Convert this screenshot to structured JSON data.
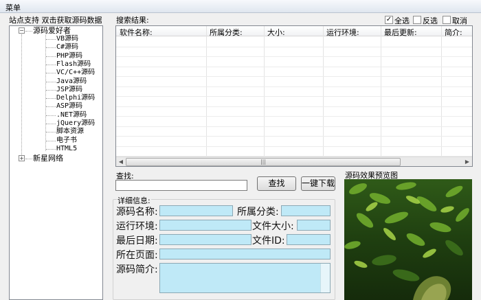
{
  "menu": {
    "label": "菜单"
  },
  "hint": {
    "text": "站点支持 双击获取源码数据"
  },
  "tree": {
    "root1": "源码爱好者",
    "children": [
      "VB源码",
      "C#源码",
      "PHP源码",
      "Flash源码",
      "VC/C++源码",
      "Java源码",
      "JSP源码",
      "Delphi源码",
      "ASP源码",
      ".NET源码",
      "jQuery源码",
      "脚本资源",
      "电子书",
      "HTML5"
    ],
    "root2": "新星网络"
  },
  "results": {
    "label": "搜索结果:",
    "columns": [
      "软件名称:",
      "所属分类:",
      "大小:",
      "运行环境:",
      "最后更新:",
      "简介:"
    ]
  },
  "select": {
    "all": "全选",
    "invert": "反选",
    "cancel": "取消",
    "all_checked": "✓"
  },
  "search": {
    "label": "查找:",
    "value": "",
    "find_button": "查找",
    "download_button": "一键下载"
  },
  "details": {
    "label": "详细信息:",
    "name": "源码名称:",
    "category": "所属分类:",
    "env": "运行环境:",
    "size": "文件大小:",
    "date": "最后日期:",
    "id": "文件ID:",
    "page": "所在页面:",
    "intro": "源码简介:"
  },
  "preview": {
    "label": "源码效果预览图"
  },
  "colors": {
    "field": "#bfe9f7",
    "window": "#f0f0f0"
  }
}
